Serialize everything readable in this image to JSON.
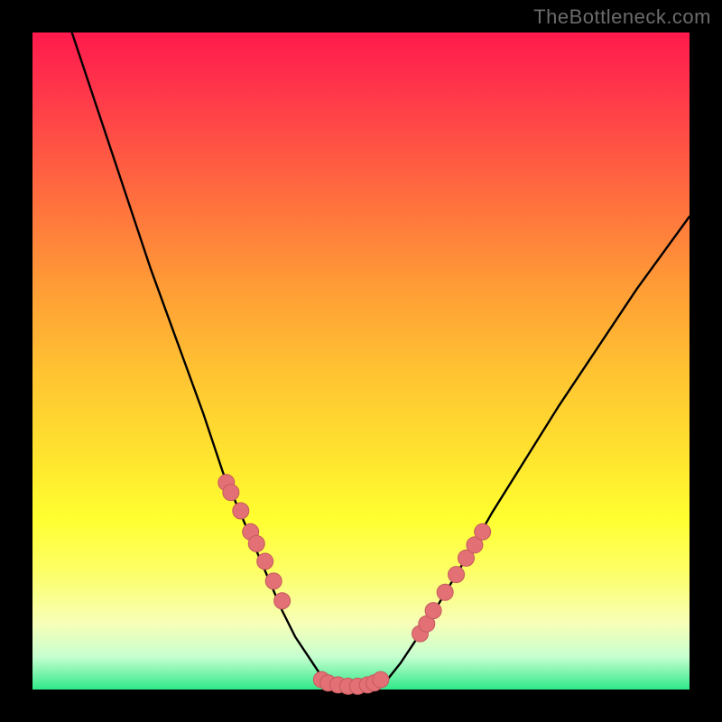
{
  "watermark": "TheBottleneck.com",
  "chart_data": {
    "type": "line",
    "title": "",
    "xlabel": "",
    "ylabel": "",
    "xlim": [
      0,
      100
    ],
    "ylim": [
      0,
      100
    ],
    "curve_left": {
      "x": [
        6,
        10,
        14,
        18,
        22,
        26,
        29,
        32,
        35,
        38,
        40,
        42,
        44,
        46
      ],
      "y": [
        100,
        88,
        76,
        64,
        53,
        42,
        33,
        26,
        19,
        12,
        8,
        5,
        2,
        0.5
      ]
    },
    "curve_right": {
      "x": [
        52,
        54,
        56,
        58,
        60,
        63,
        66,
        70,
        75,
        80,
        86,
        92,
        100
      ],
      "y": [
        0.5,
        1.5,
        4,
        7,
        10,
        15,
        20,
        27,
        35,
        43,
        52,
        61,
        72
      ]
    },
    "floor": {
      "x": [
        46,
        47,
        48,
        49,
        50,
        51,
        52
      ],
      "y": [
        0.5,
        0.3,
        0.2,
        0.2,
        0.2,
        0.3,
        0.5
      ]
    },
    "markers_left": {
      "x": [
        29.5,
        30.2,
        31.7,
        33.2,
        34.1,
        35.4,
        36.7,
        38.0
      ],
      "y": [
        31.5,
        30.0,
        27.2,
        24.0,
        22.2,
        19.5,
        16.5,
        13.5
      ]
    },
    "markers_right": {
      "x": [
        59.0,
        60.0,
        61.0,
        62.8,
        64.5,
        66.0,
        67.3,
        68.5
      ],
      "y": [
        8.5,
        10.0,
        12.0,
        14.8,
        17.5,
        20.0,
        22.0,
        24.0
      ]
    },
    "markers_floor": {
      "x": [
        44.0,
        45.0,
        46.5,
        48.0,
        49.5,
        51.0,
        52.0,
        53.0
      ],
      "y": [
        1.5,
        1.0,
        0.7,
        0.5,
        0.5,
        0.7,
        1.0,
        1.5
      ]
    },
    "colors": {
      "curve": "#000000",
      "marker_fill": "#e27074",
      "marker_stroke": "#c55a5e"
    }
  }
}
